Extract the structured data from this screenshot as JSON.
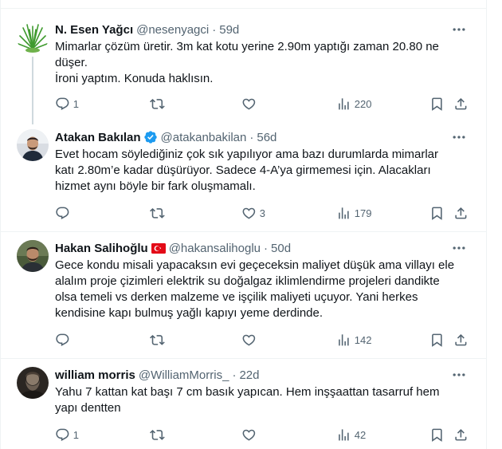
{
  "tweets": [
    {
      "name": "N. Esen Yağcı",
      "handle": "@nesenyagci",
      "sep": "·",
      "time": "59d",
      "lines": [
        "Mimarlar çözüm üretir. 3m kat kotu yerine 2.90m yaptığı zaman 20.80 ne",
        "düşer.",
        "İroni yaptım. Konuda haklısın."
      ],
      "replies": "1",
      "retweets": "",
      "likes": "",
      "views": "220"
    },
    {
      "name": "Atakan Bakılan",
      "handle": "@atakanbakilan",
      "sep": "·",
      "time": "56d",
      "lines": [
        "Evet hocam söylediğiniz çok sık yapılıyor ama bazı durumlarda mimarlar",
        "katı 2.80m’e kadar düşürüyor. Sadece 4-A’ya girmemesi için. Alacakları",
        "hizmet aynı böyle bir fark oluşmamalı."
      ],
      "replies": "",
      "retweets": "",
      "likes": "3",
      "views": "179"
    },
    {
      "name": "Hakan Salihoğlu",
      "handle": "@hakansalihoglu",
      "sep": "·",
      "time": "50d",
      "lines": [
        "Gece kondu misali yapacaksın evi geçeceksin maliyet düşük ama villayı ele",
        "alalım proje çizimleri elektrik su doğalgaz iklimlendirme projeleri dandikte",
        "olsa temeli vs derken malzeme ve işçilik maliyeti uçuyor. Yani herkes",
        "kendisine kapı bulmuş yağlı kapıyı yeme derdinde."
      ],
      "replies": "",
      "retweets": "",
      "likes": "",
      "views": "142"
    },
    {
      "name": "william morris",
      "handle": "@WilliamMorris_",
      "sep": "·",
      "time": "22d",
      "lines": [
        "Yahu 7 kattan kat başı 7 cm basık yapıcan. Hem inşşaattan tasarruf hem",
        "yapı dentten"
      ],
      "replies": "1",
      "retweets": "",
      "likes": "",
      "views": "42"
    }
  ],
  "icons": {
    "reply": "reply-icon",
    "retweet": "retweet-icon",
    "like": "like-icon",
    "views": "views-icon",
    "bookmark": "bookmark-icon",
    "share": "share-icon",
    "more": "more-icon",
    "verified": "verified-badge-icon",
    "flag": "turkey-flag-icon"
  },
  "colors": {
    "text": "#0f1419",
    "secondary": "#536471",
    "verified": "#1d9bf0",
    "divider": "#eff3f4",
    "thread": "#cfd9de"
  }
}
